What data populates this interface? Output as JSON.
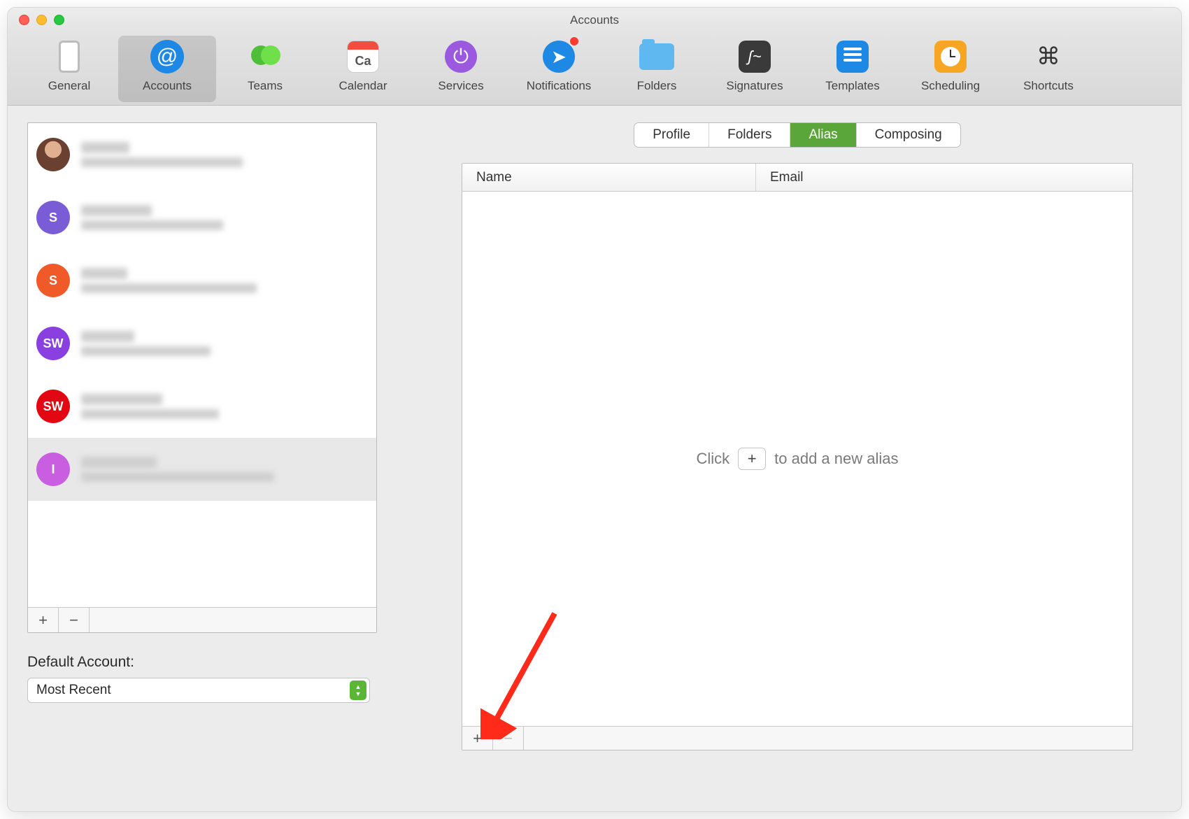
{
  "window": {
    "title": "Accounts"
  },
  "toolbar": {
    "items": [
      {
        "id": "general",
        "label": "General"
      },
      {
        "id": "accounts",
        "label": "Accounts"
      },
      {
        "id": "teams",
        "label": "Teams"
      },
      {
        "id": "calendar",
        "label": "Calendar",
        "icon_text": "Ca"
      },
      {
        "id": "services",
        "label": "Services"
      },
      {
        "id": "notifications",
        "label": "Notifications",
        "badge": true
      },
      {
        "id": "folders",
        "label": "Folders"
      },
      {
        "id": "signatures",
        "label": "Signatures"
      },
      {
        "id": "templates",
        "label": "Templates"
      },
      {
        "id": "scheduling",
        "label": "Scheduling"
      },
      {
        "id": "shortcuts",
        "label": "Shortcuts"
      }
    ],
    "active_id": "accounts"
  },
  "accounts": {
    "items": [
      {
        "avatar_kind": "photo",
        "avatar_text": "",
        "avatar_color": "#9a8070"
      },
      {
        "avatar_kind": "letter",
        "avatar_text": "S",
        "avatar_color": "#7a5cd6"
      },
      {
        "avatar_kind": "letter",
        "avatar_text": "S",
        "avatar_color": "#f05a28"
      },
      {
        "avatar_kind": "letter",
        "avatar_text": "SW",
        "avatar_color": "#8a3fe0"
      },
      {
        "avatar_kind": "letter",
        "avatar_text": "SW",
        "avatar_color": "#e30613"
      },
      {
        "avatar_kind": "letter",
        "avatar_text": "I",
        "avatar_color": "#c95fe0",
        "selected": true
      }
    ]
  },
  "default_account": {
    "label": "Default Account:",
    "value": "Most Recent"
  },
  "tabs": {
    "items": [
      {
        "id": "profile",
        "label": "Profile"
      },
      {
        "id": "folders2",
        "label": "Folders"
      },
      {
        "id": "alias",
        "label": "Alias"
      },
      {
        "id": "composing",
        "label": "Composing"
      }
    ],
    "active_id": "alias"
  },
  "alias_table": {
    "columns": {
      "name": "Name",
      "email": "Email"
    },
    "placeholder_prefix": "Click",
    "placeholder_suffix": "to add a new alias"
  },
  "symbols": {
    "plus": "+",
    "minus": "−"
  },
  "colors": {
    "accent_blue": "#1e88e5",
    "accent_green": "#5aa63a",
    "orange": "#f6a623",
    "purple": "#9b59e0",
    "dark_square": "#3a3a3a"
  }
}
